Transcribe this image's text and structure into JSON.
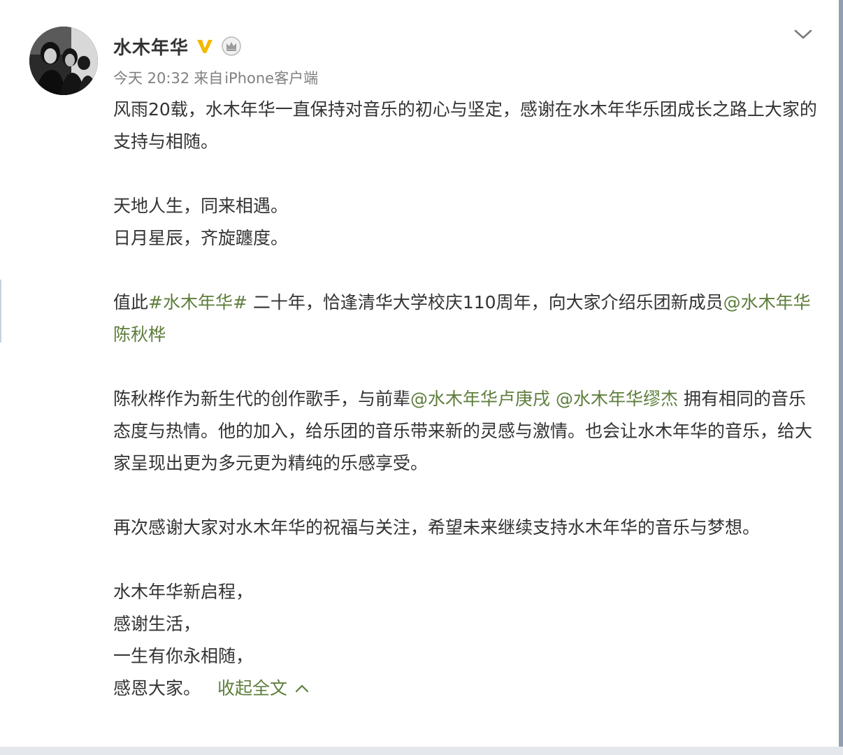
{
  "post": {
    "author": "水木年华",
    "badges": [
      "verified-v-icon",
      "crown-icon"
    ],
    "time": "今天 20:32",
    "source_prefix": "来自",
    "source": "iPhone客户端"
  },
  "content": {
    "p1": "风雨20载，水木年华一直保持对音乐的初心与坚定，感谢在水木年华乐团成长之路上大家的支持与相随。",
    "p2_line1": "天地人生，同来相遇。",
    "p2_line2": "日月星辰，齐旋躔度。",
    "p3_before": "值此",
    "p3_hashtag": "#水木年华#",
    "p3_middle": " 二十年，恰逢清华大学校庆110周年，向大家介绍乐团新成员",
    "p3_mention": "@水木年华陈秋桦",
    "p4_before": "陈秋桦作为新生代的创作歌手，与前辈",
    "p4_mention1": "@水木年华卢庚戌",
    "p4_space": " ",
    "p4_mention2": "@水木年华缪杰",
    "p4_after": " 拥有相同的音乐态度与热情。他的加入，给乐团的音乐带来新的灵感与激情。也会让水木年华的音乐，给大家呈现出更为多元更为精纯的乐感享受。",
    "p5": "再次感谢大家对水木年华的祝福与关注，希望未来继续支持水木年华的音乐与梦想。",
    "p6_line1": "水木年华新启程，",
    "p6_line2": "感谢生活，",
    "p6_line3": "一生有你永相随，",
    "p6_line4": "感恩大家。",
    "collapse_label": "收起全文"
  },
  "colors": {
    "link": "#5e7e3c",
    "meta": "#808080",
    "text": "#333333",
    "verified": "#f5b800"
  }
}
